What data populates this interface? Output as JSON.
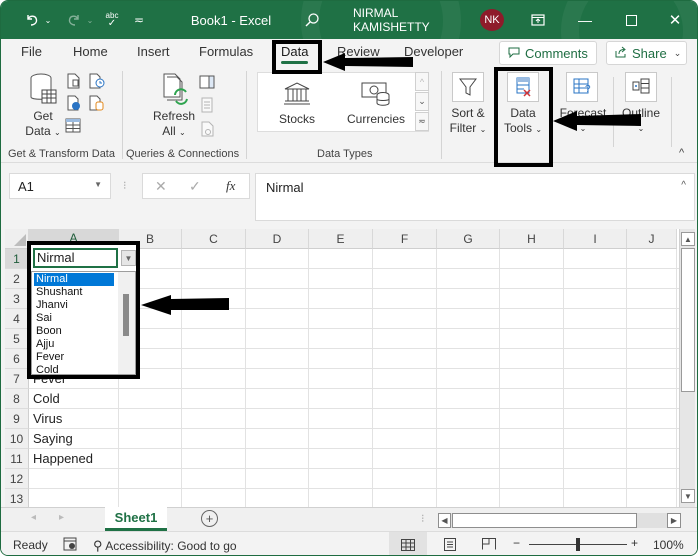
{
  "titlebar": {
    "app_title": "Book1  -  Excel",
    "user_name": "NIRMAL KAMISHETTY",
    "user_initials": "NK",
    "icons": [
      "undo-icon",
      "redo-icon",
      "spelling-icon",
      "customize-qat-icon",
      "search-icon",
      "ribbon-display-icon",
      "minimize-icon",
      "maximize-icon",
      "close-icon"
    ]
  },
  "tabs": {
    "items": [
      {
        "label": "File"
      },
      {
        "label": "Home"
      },
      {
        "label": "Insert"
      },
      {
        "label": "Formulas"
      },
      {
        "label": "Data",
        "active": true
      },
      {
        "label": "Review"
      },
      {
        "label": "Developer"
      }
    ],
    "comments_label": "Comments",
    "share_label": "Share"
  },
  "ribbon": {
    "groups": [
      {
        "label": "Get & Transform Data",
        "buttons": [
          {
            "label_line1": "Get",
            "label_line2": "Data"
          }
        ]
      },
      {
        "label": "Queries & Connections",
        "buttons": [
          {
            "label_line1": "Refresh",
            "label_line2": "All"
          }
        ]
      },
      {
        "label": "Data Types",
        "buttons": [
          {
            "label": "Stocks"
          },
          {
            "label": "Currencies"
          }
        ]
      },
      {
        "label": "",
        "buttons": [
          {
            "label_line1": "Sort &",
            "label_line2": "Filter"
          },
          {
            "label_line1": "Data",
            "label_line2": "Tools"
          },
          {
            "label_line1": "Forecast",
            "label_line2": ""
          },
          {
            "label_line1": "Outline",
            "label_line2": ""
          }
        ]
      }
    ]
  },
  "formula_bar": {
    "name_box": "A1",
    "formula": "Nirmal",
    "fx_label": "fx"
  },
  "grid": {
    "columns": [
      "A",
      "B",
      "C",
      "D",
      "E",
      "F",
      "G",
      "H",
      "I",
      "J"
    ],
    "selected_column": "A",
    "rows": [
      "1",
      "2",
      "3",
      "4",
      "5",
      "6",
      "7",
      "8",
      "9",
      "10",
      "11",
      "12",
      "13"
    ],
    "cells": {
      "A1": "Nirmal",
      "A7": "Fever",
      "A8": "Cold",
      "A9": "Virus",
      "A10": "Saying",
      "A11": "Happened"
    }
  },
  "dropdown": {
    "current_value": "Nirmal",
    "items": [
      "Nirmal",
      "Shushant",
      "Jhanvi",
      "Sai",
      "Boon",
      "Ajju",
      "Fever",
      "Cold"
    ],
    "selected_index": 0
  },
  "sheets": {
    "tabs": [
      "Sheet1"
    ],
    "active": "Sheet1",
    "add_label": "+"
  },
  "statusbar": {
    "ready": "Ready",
    "accessibility": "Accessibility: Good to go",
    "zoom_minus": "−",
    "zoom_plus": "+",
    "zoom_level": "100%",
    "zoom_slider_fraction": 0.5
  },
  "colors": {
    "accent": "#1f7145",
    "avatar": "#8e1b2a",
    "selection": "#0078d7"
  }
}
